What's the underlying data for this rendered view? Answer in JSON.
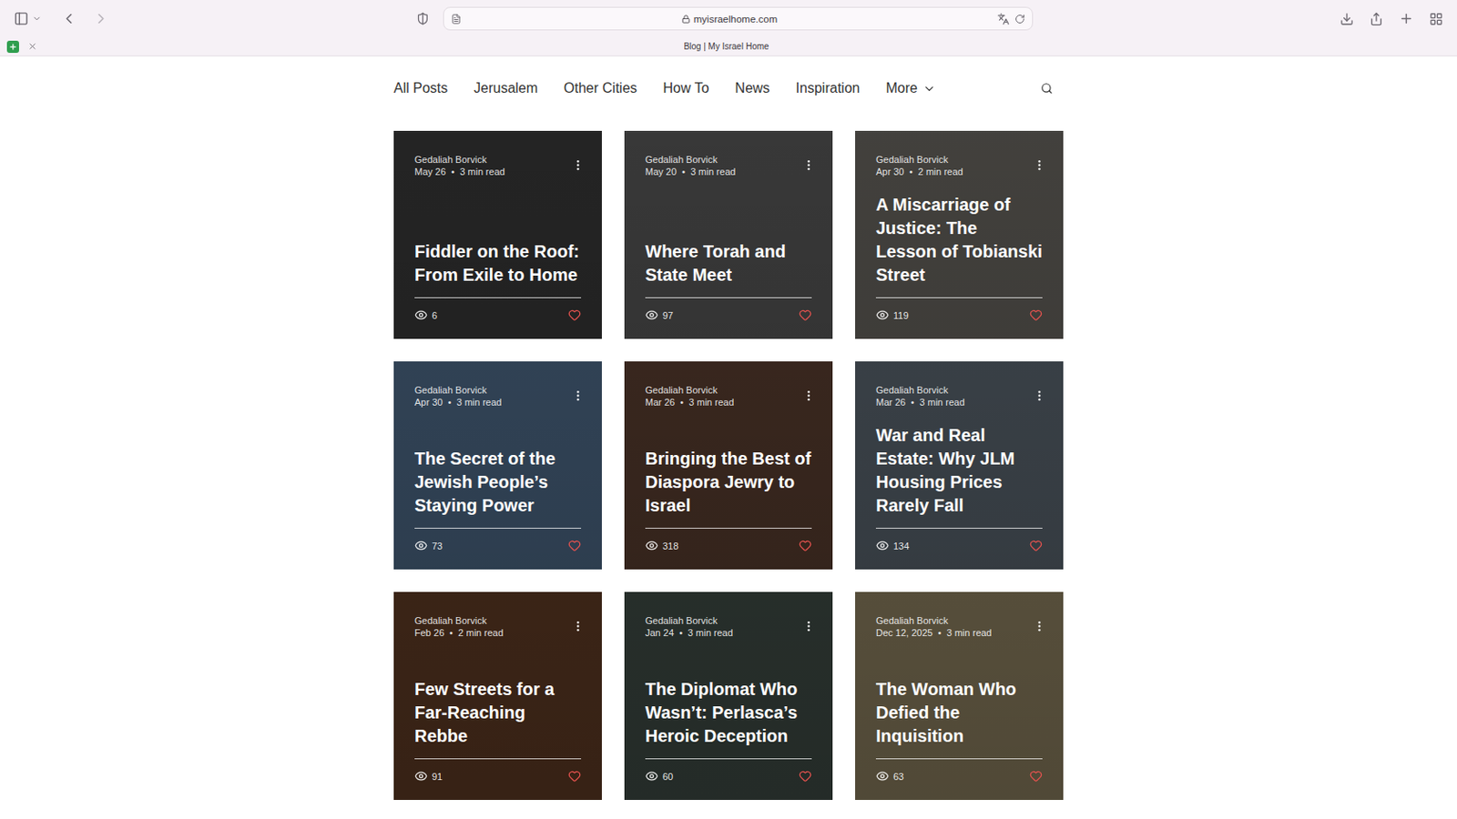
{
  "browser": {
    "url": "myisraelhome.com",
    "tab_title": "Blog | My Israel Home"
  },
  "nav": {
    "items": [
      {
        "label": "All Posts",
        "selected": false
      },
      {
        "label": "Jerusalem",
        "selected": false
      },
      {
        "label": "Other Cities",
        "selected": false
      },
      {
        "label": "How To",
        "selected": false
      },
      {
        "label": "News",
        "selected": false
      },
      {
        "label": "Inspiration",
        "selected": false
      }
    ],
    "more": "More"
  },
  "posts": [
    {
      "author": "Gedaliah Borvick",
      "date": "May 26",
      "read_time": "3 min read",
      "title": "Fiddler on the Roof: From Exile to Home",
      "views": "6",
      "liked": false,
      "color": "#3a3a3a"
    },
    {
      "author": "Gedaliah Borvick",
      "date": "May 20",
      "read_time": "3 min read",
      "title": "Where Torah and State Meet",
      "views": "97",
      "liked": false,
      "color": "#5a5a5a"
    },
    {
      "author": "Gedaliah Borvick",
      "date": "Apr 30",
      "read_time": "2 min read",
      "title": "A Miscarriage of Justice: The Lesson of Tobianski Street",
      "views": "119",
      "liked": false,
      "color": "#6b6862"
    },
    {
      "author": "Gedaliah Borvick",
      "date": "Apr 30",
      "read_time": "3 min read",
      "title": "The Secret of the Jewish People’s Staying Power",
      "views": "73",
      "liked": false,
      "color": "#4e6a88"
    },
    {
      "author": "Gedaliah Borvick",
      "date": "Mar 26",
      "read_time": "3 min read",
      "title": "Bringing the Best of Diaspora Jewry to Israel",
      "views": "318",
      "liked": false,
      "color": "#5a3e30"
    },
    {
      "author": "Gedaliah Borvick",
      "date": "Mar 26",
      "read_time": "3 min read",
      "title": "War and Real Estate: Why JLM Housing Prices Rarely Fall",
      "views": "134",
      "liked": false,
      "color": "#5b6670"
    },
    {
      "author": "Gedaliah Borvick",
      "date": "Feb 26",
      "read_time": "2 min read",
      "title": "Few Streets for a Far-Reaching Rebbe",
      "views": "91",
      "liked": false,
      "color": "#5e3a24"
    },
    {
      "author": "Gedaliah Borvick",
      "date": "Jan 24",
      "read_time": "3 min read",
      "title": "The Diplomat Who Wasn’t: Perlasca’s Heroic Deception",
      "views": "60",
      "liked": false,
      "color": "#3e4a44"
    },
    {
      "author": "Gedaliah Borvick",
      "date": "Dec 12, 2025",
      "read_time": "3 min read",
      "title": "The Woman Who Defied the Inquisition",
      "views": "63",
      "liked": false,
      "color": "#8a7d5e"
    }
  ]
}
